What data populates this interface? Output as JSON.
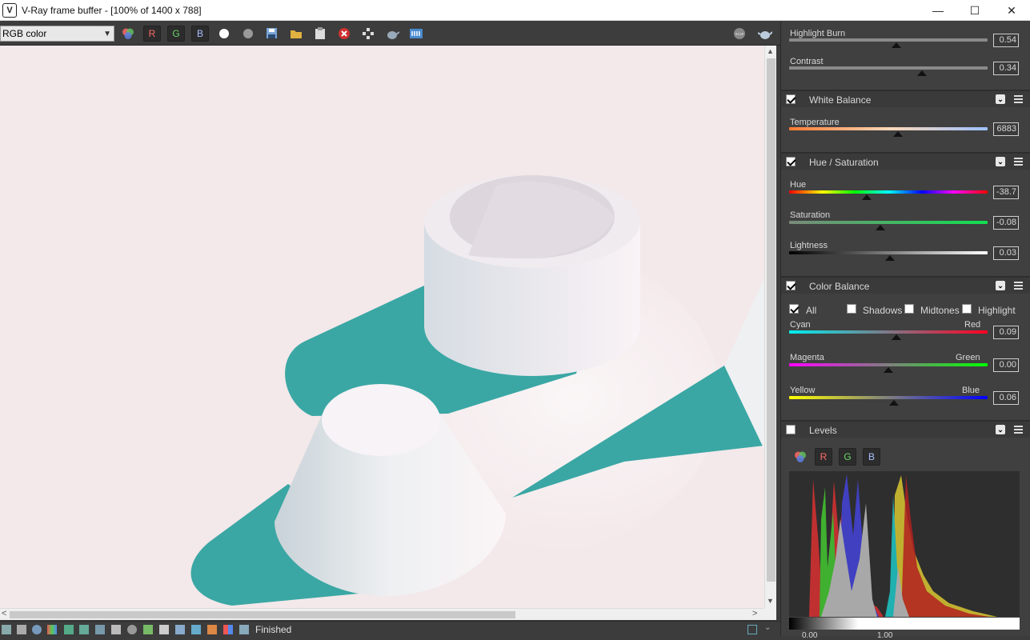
{
  "window": {
    "title": "V-Ray frame buffer - [100% of 1400 x 788]",
    "app_icon_glyph": "V",
    "min": "—",
    "max": "☐",
    "close": "✕"
  },
  "toolbar": {
    "channel_select": "RGB color",
    "r_label": "R",
    "g_label": "G",
    "b_label": "B",
    "icons": [
      "color-channels-icon",
      "white-circle-icon",
      "grey-circle-icon",
      "save-icon",
      "open-folder-icon",
      "clipboard-icon",
      "clear-icon",
      "track-mouse-icon",
      "teapot-icon",
      "lens-effects-icon",
      "stop-icon",
      "render-teapot-icon"
    ]
  },
  "status": {
    "text": "Finished"
  },
  "panel": {
    "highlight_burn": {
      "label": "Highlight Burn",
      "value": "0.54",
      "level": 0.54
    },
    "contrast": {
      "label": "Contrast",
      "value": "0.34",
      "level": 0.67
    },
    "white_balance": {
      "title": "White Balance",
      "checked": true,
      "temperature": {
        "label": "Temperature",
        "value": "6883",
        "level": 0.55
      }
    },
    "hue_saturation": {
      "title": "Hue / Saturation",
      "checked": true,
      "hue": {
        "label": "Hue",
        "value": "-38.7",
        "level": 0.39
      },
      "saturation": {
        "label": "Saturation",
        "value": "-0.08",
        "level": 0.46
      },
      "lightness": {
        "label": "Lightness",
        "value": "0.03",
        "level": 0.51
      }
    },
    "color_balance": {
      "title": "Color Balance",
      "checked": true,
      "options": {
        "all": "All",
        "shadows": "Shadows",
        "midtones": "Midtones",
        "highlight": "Highlight"
      },
      "cyan_red": {
        "left": "Cyan",
        "right": "Red",
        "value": "0.09",
        "level": 0.54
      },
      "magenta_green": {
        "left": "Magenta",
        "right": "Green",
        "value": "0.00",
        "level": 0.5
      },
      "yellow_blue": {
        "left": "Yellow",
        "right": "Blue",
        "value": "0.06",
        "level": 0.53
      }
    },
    "levels": {
      "title": "Levels",
      "checked": false,
      "r_label": "R",
      "g_label": "G",
      "b_label": "B",
      "low_value": "0.00",
      "high_value": "1.00"
    }
  }
}
